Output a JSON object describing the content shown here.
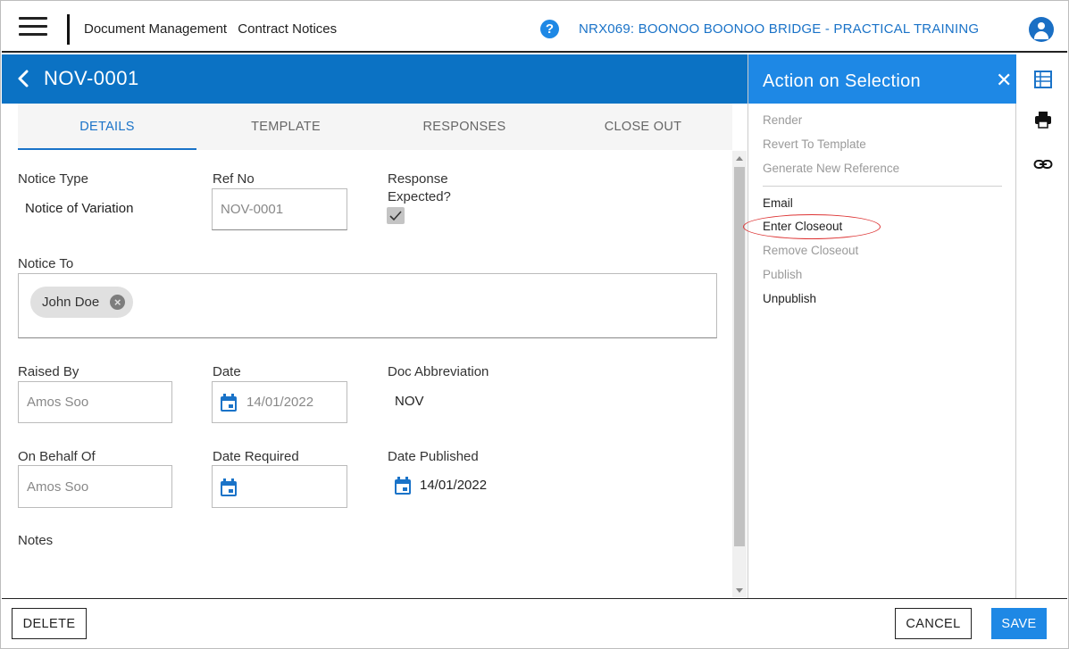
{
  "topbar": {
    "breadcrumbs": [
      "Document Management",
      "Contract Notices"
    ],
    "project": "NRX069: BOONOO BOONOO BRIDGE - PRACTICAL TRAINING"
  },
  "document": {
    "title": "NOV-0001"
  },
  "tabs": [
    {
      "label": "DETAILS",
      "active": true
    },
    {
      "label": "TEMPLATE",
      "active": false
    },
    {
      "label": "RESPONSES",
      "active": false
    },
    {
      "label": "CLOSE OUT",
      "active": false
    }
  ],
  "form": {
    "notice_type": {
      "label": "Notice Type",
      "value": "Notice of Variation"
    },
    "ref_no": {
      "label": "Ref No",
      "value": "NOV-0001"
    },
    "response_expected": {
      "label_line1": "Response",
      "label_line2": "Expected?",
      "checked": true
    },
    "notice_to": {
      "label": "Notice To",
      "recipients": [
        "John Doe"
      ]
    },
    "raised_by": {
      "label": "Raised By",
      "value": "Amos Soo"
    },
    "date": {
      "label": "Date",
      "value": "14/01/2022"
    },
    "doc_abbreviation": {
      "label": "Doc Abbreviation",
      "value": "NOV"
    },
    "on_behalf_of": {
      "label": "On Behalf Of",
      "value": "Amos Soo"
    },
    "date_required": {
      "label": "Date Required",
      "value": ""
    },
    "date_published": {
      "label": "Date Published",
      "value": "14/01/2022"
    },
    "notes": {
      "label": "Notes"
    }
  },
  "action_panel": {
    "title": "Action on Selection",
    "actions": [
      {
        "label": "Render",
        "enabled": false
      },
      {
        "label": "Revert To Template",
        "enabled": false
      },
      {
        "label": "Generate New Reference",
        "enabled": false
      },
      {
        "label": "Email",
        "enabled": true
      },
      {
        "label": "Enter Closeout",
        "enabled": true,
        "highlighted": true
      },
      {
        "label": "Remove Closeout",
        "enabled": false
      },
      {
        "label": "Publish",
        "enabled": false
      },
      {
        "label": "Unpublish",
        "enabled": true
      }
    ]
  },
  "footer": {
    "delete_label": "DELETE",
    "cancel_label": "CANCEL",
    "save_label": "SAVE"
  },
  "colors": {
    "primary": "#0b72c4",
    "accent": "#1e88e5",
    "highlight": "#dd3333"
  }
}
